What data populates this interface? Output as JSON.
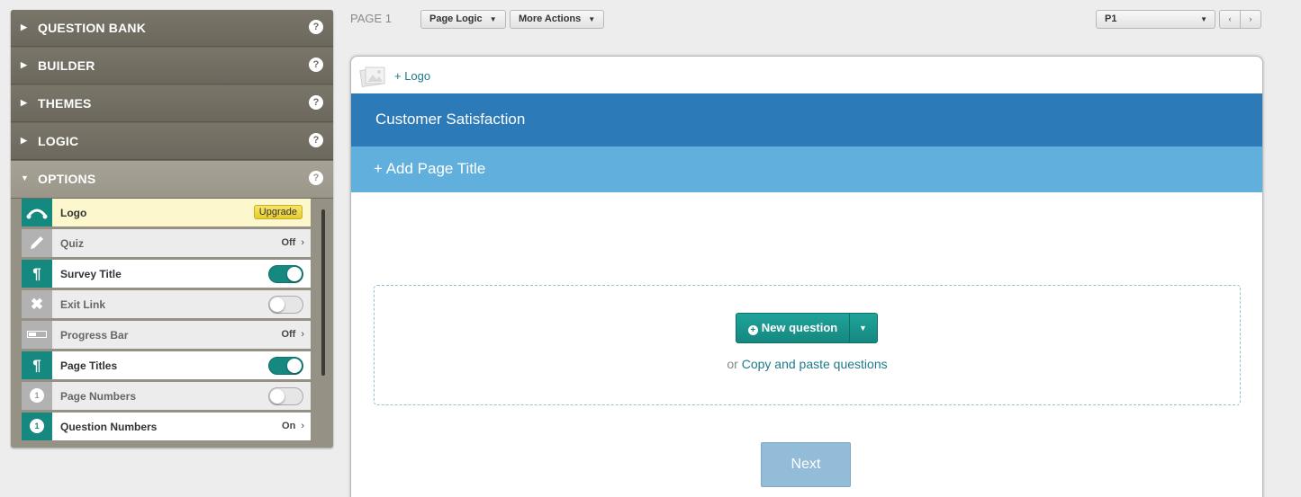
{
  "sidebar": {
    "sections": [
      {
        "label": "QUESTION BANK",
        "expanded": false
      },
      {
        "label": "BUILDER",
        "expanded": false
      },
      {
        "label": "THEMES",
        "expanded": false
      },
      {
        "label": "LOGIC",
        "expanded": false
      },
      {
        "label": "OPTIONS",
        "expanded": true
      }
    ],
    "help_glyph": "?",
    "options": [
      {
        "label": "Logo",
        "control": "upgrade",
        "upgrade_label": "Upgrade",
        "icon": "logo-icon"
      },
      {
        "label": "Quiz",
        "control": "value",
        "value": "Off",
        "icon": "pencil-icon"
      },
      {
        "label": "Survey Title",
        "control": "toggle",
        "on": true,
        "icon": "paragraph-icon"
      },
      {
        "label": "Exit Link",
        "control": "toggle",
        "on": false,
        "icon": "close-icon"
      },
      {
        "label": "Progress Bar",
        "control": "value",
        "value": "Off",
        "icon": "progress-bar-icon"
      },
      {
        "label": "Page Titles",
        "control": "toggle",
        "on": true,
        "icon": "paragraph-icon"
      },
      {
        "label": "Page Numbers",
        "control": "toggle",
        "on": false,
        "icon": "number-icon"
      },
      {
        "label": "Question Numbers",
        "control": "value",
        "value": "On",
        "icon": "number-icon"
      }
    ],
    "number_glyph": "1"
  },
  "topbar": {
    "page_label": "PAGE 1",
    "page_logic_label": "Page Logic",
    "more_actions_label": "More Actions",
    "page_select_value": "P1",
    "prev_glyph": "‹",
    "next_glyph": "›"
  },
  "survey": {
    "add_logo_label": "+ Logo",
    "title": "Customer Satisfaction",
    "add_page_title_label": "+ Add Page Title",
    "new_question_label": "New question",
    "or_text": "or",
    "copy_paste_label": "Copy and paste questions",
    "next_label": "Next"
  },
  "colors": {
    "accent_teal": "#15887f",
    "title_band": "#2c7ab7",
    "page_title_band": "#61afdc",
    "next_button": "#93bcd9"
  }
}
